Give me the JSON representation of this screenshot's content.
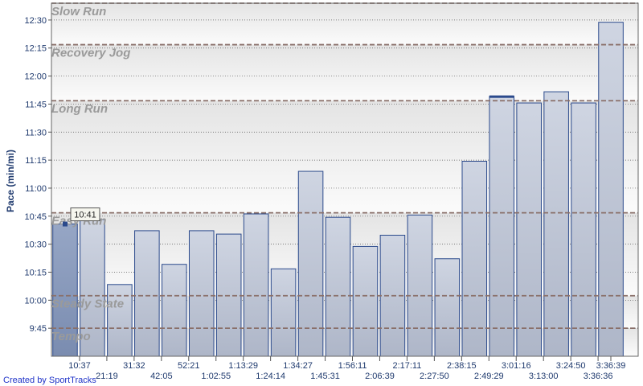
{
  "chart_data": {
    "type": "bar",
    "ylabel": "Pace (min/mi)",
    "ylim": [
      9.5,
      12.65
    ],
    "yticks": [
      {
        "value": 9.75,
        "label": "9:45"
      },
      {
        "value": 10.0,
        "label": "10:00"
      },
      {
        "value": 10.25,
        "label": "10:15"
      },
      {
        "value": 10.5,
        "label": "10:30"
      },
      {
        "value": 10.75,
        "label": "10:45"
      },
      {
        "value": 11.0,
        "label": "11:00"
      },
      {
        "value": 11.25,
        "label": "11:15"
      },
      {
        "value": 11.5,
        "label": "11:30"
      },
      {
        "value": 11.75,
        "label": "11:45"
      },
      {
        "value": 12.0,
        "label": "12:00"
      },
      {
        "value": 12.25,
        "label": "12:15"
      },
      {
        "value": 12.5,
        "label": "12:30"
      }
    ],
    "categories": [
      "10:37",
      "21:19",
      "31:32",
      "42:05",
      "52:21",
      "1:02:55",
      "1:13:29",
      "1:24:14",
      "1:34:27",
      "1:45:31",
      "1:56:11",
      "2:06:39",
      "2:17:11",
      "2:27:50",
      "2:38:15",
      "2:49:29",
      "3:01:16",
      "3:13:00",
      "3:24:50",
      "3:36:36",
      "3:36:39"
    ],
    "values": [
      10.68,
      10.72,
      10.14,
      10.62,
      10.32,
      10.62,
      10.59,
      10.77,
      10.28,
      11.15,
      10.74,
      10.48,
      10.58,
      10.76,
      10.37,
      11.24,
      11.82,
      11.76,
      11.86,
      11.76,
      12.48
    ],
    "zones": [
      {
        "name": "Slow Run",
        "value": 12.65
      },
      {
        "name": "Recovery Jog",
        "value": 12.28
      },
      {
        "name": "Long Run",
        "value": 11.78
      },
      {
        "name": "Easy Run",
        "value": 10.78
      },
      {
        "name": "Steady State",
        "value": 10.04
      },
      {
        "name": "Tempo",
        "value": 9.75
      }
    ],
    "highlight_index": 0,
    "tooltip": "10:41",
    "grid": true,
    "legend": "none"
  },
  "credit": "Created by SportTracks",
  "colors": {
    "bar_fill": "#c5cbd9",
    "bar_fill_selected": "#8e9fbf",
    "bar_stroke": "#2b4a8c",
    "zone_line": "#8a706a",
    "axis_text": "#1f3a6e",
    "credit_text": "#1f33c8"
  }
}
